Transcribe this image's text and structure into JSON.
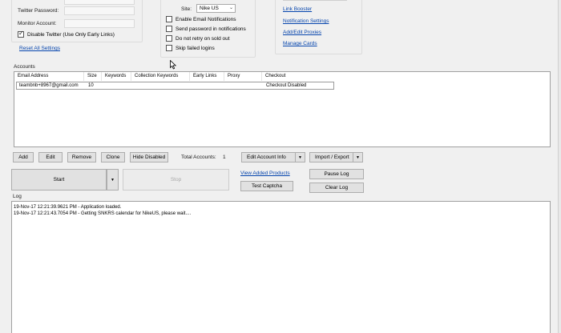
{
  "twitter": {
    "password_label": "Twitter Password:",
    "monitor_label": "Monitor Account:",
    "disable_label": "Disable Twitter (Use Only Early Links)",
    "reset_link": "Reset All Settings"
  },
  "options": {
    "site_label": "Site:",
    "site_value": "Nike US",
    "email_notifications": "Enable Email Notifications",
    "send_password": "Send password in notifications",
    "no_retry": "Do not retry on sold out",
    "skip_failed": "Skip failed logins"
  },
  "links": {
    "link_booster": "Link Booster",
    "notification_settings": "Notification Settings",
    "add_edit_proxies": "Add/Edit Proxies",
    "manage_cards": "Manage Cards"
  },
  "accounts": {
    "section_label": "Accounts",
    "columns": [
      "Email Address",
      "Size",
      "Keywords",
      "Collection Keywords",
      "Early Links",
      "Proxy",
      "Checkout"
    ],
    "rows": [
      {
        "email": "teambnb+8967@gmail.com",
        "size": "10",
        "keywords": "",
        "collection": "",
        "early": "",
        "proxy": "",
        "checkout": "Checkout Disabled"
      }
    ]
  },
  "toolbar": {
    "add": "Add",
    "edit": "Edit",
    "remove": "Remove",
    "clone": "Clone",
    "hide_disabled": "Hide Disabled",
    "total_label": "Total Accounts:",
    "total_value": "1",
    "edit_account_info": "Edit Account Info",
    "import_export": "Import / Export"
  },
  "controls": {
    "start": "Start",
    "stop": "Stop",
    "view_products": "View Added Products",
    "test_captcha": "Test Captcha",
    "pause_log": "Pause Log",
    "clear_log": "Clear Log"
  },
  "log": {
    "label": "Log",
    "lines": [
      "19-Nov-17 12:21:39.9621 PM - Application loaded.",
      "19-Nov-17 12:21:43.7054 PM - Getting SNKRS calendar for NikeUS, please wait...."
    ]
  }
}
